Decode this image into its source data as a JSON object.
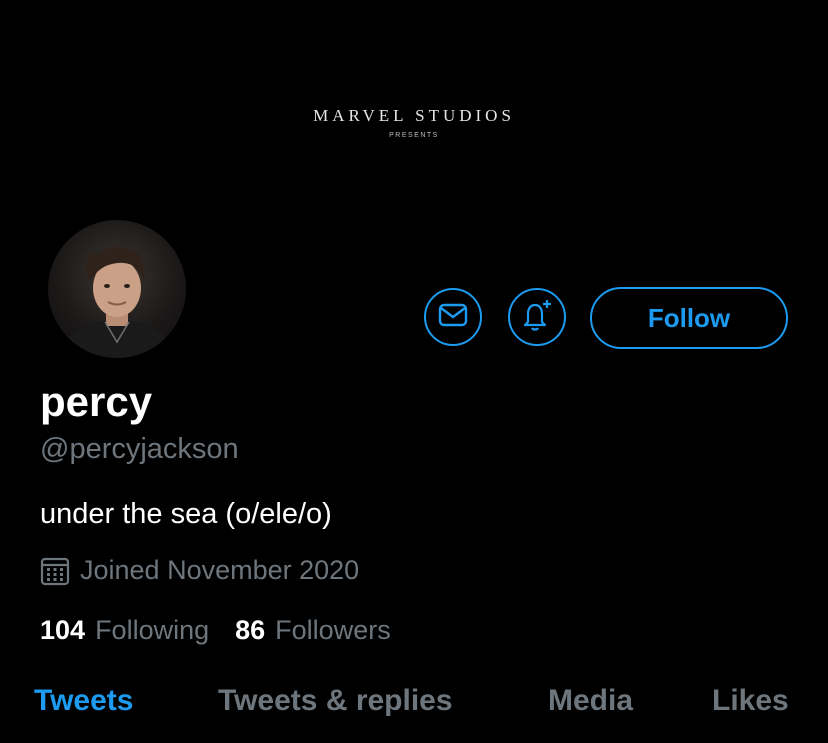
{
  "banner": {
    "title": "MARVEL STUDIOS",
    "subtitle": "PRESENTS"
  },
  "profile": {
    "display_name": "percy",
    "handle": "@percyjackson",
    "bio": "under the sea (o/ele/o)",
    "joined": "Joined November 2020",
    "avatar_icon": "profile-photo"
  },
  "actions": {
    "message_icon": "mail-icon",
    "notify_icon": "bell-plus-icon",
    "follow_label": "Follow",
    "accent_color": "#1d9bf0"
  },
  "stats": {
    "following_count": "104",
    "following_label": "Following",
    "followers_count": "86",
    "followers_label": "Followers"
  },
  "tabs": [
    {
      "label": "Tweets",
      "active": true
    },
    {
      "label": "Tweets & replies",
      "active": false
    },
    {
      "label": "Media",
      "active": false
    },
    {
      "label": "Likes",
      "active": false
    }
  ]
}
